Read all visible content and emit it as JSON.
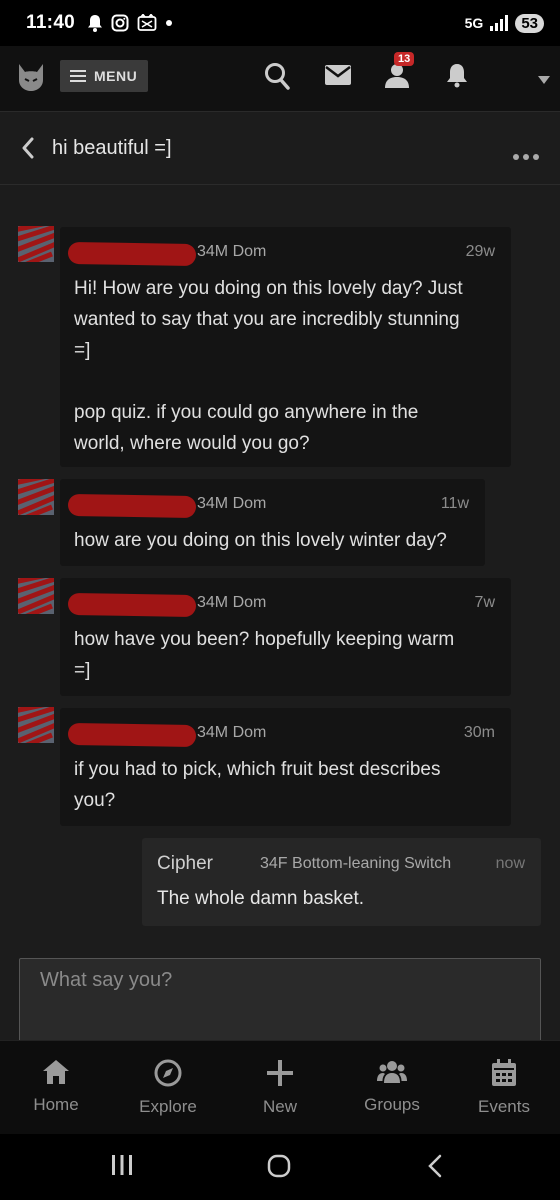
{
  "status_bar": {
    "time": "11:40",
    "network": "5G",
    "battery": "53"
  },
  "nav": {
    "menu_label": "MENU",
    "notification_count": "13"
  },
  "conversation": {
    "title": "hi beautiful =]"
  },
  "messages": [
    {
      "sender_meta": "34M Dom",
      "time": "29w",
      "text": "Hi! How are you doing on this lovely day? Just\nwanted to say that you are incredibly stunning\n=]\n\npop quiz. if you could go anywhere in the\nworld, where would you go?"
    },
    {
      "sender_meta": "34M Dom",
      "time": "11w",
      "text": "how are you doing on this lovely winter day?"
    },
    {
      "sender_meta": "34M Dom",
      "time": "7w",
      "text": "how have you been? hopefully keeping warm\n=]"
    },
    {
      "sender_meta": "34M Dom",
      "time": "30m",
      "text": "if you had to pick, which fruit best describes\nyou?"
    }
  ],
  "my_message": {
    "name": "Cipher",
    "meta": "34F Bottom-leaning Switch",
    "time": "now",
    "text": "The whole damn basket."
  },
  "reply": {
    "placeholder": "What say you?"
  },
  "bottom_nav": [
    {
      "label": "Home",
      "icon": "home-icon"
    },
    {
      "label": "Explore",
      "icon": "compass-icon"
    },
    {
      "label": "New",
      "icon": "plus-icon"
    },
    {
      "label": "Groups",
      "icon": "groups-icon"
    },
    {
      "label": "Events",
      "icon": "calendar-icon"
    }
  ]
}
